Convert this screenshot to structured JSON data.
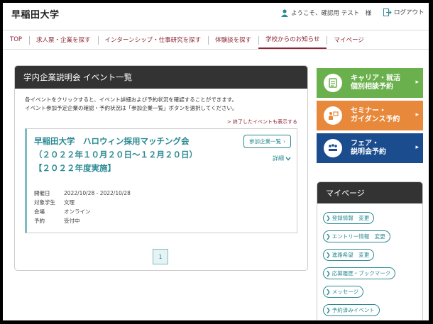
{
  "header": {
    "logo": "早稲田大学",
    "welcome": "ようこそ、確認用 テスト　様",
    "logout": "ログアウト"
  },
  "nav": [
    {
      "label": "TOP",
      "active": false
    },
    {
      "label": "求人票・企業を探す",
      "active": false
    },
    {
      "label": "インターンシップ・仕事研究を探す",
      "active": false
    },
    {
      "label": "体験談を探す",
      "active": false
    },
    {
      "label": "学校からのお知らせ",
      "active": true
    },
    {
      "label": "マイページ",
      "active": false
    }
  ],
  "panel": {
    "title": "学内企業説明会 イベント一覧",
    "intro_line1": "各イベントをクリックすると、イベント詳細および予約状況を確認することができます。",
    "intro_line2": "イベント参加予定企業の確認・予約状況は「参加企業一覧」ボタンを選択してください。",
    "past_link": "> 終了したイベントも表示する"
  },
  "event": {
    "title_line1": "早稲田大学　ハロウィン採用マッチング会",
    "title_line2": "（２０２２年１０月２０日～１２月２０日）",
    "title_line3": "【２０２２年度実施】",
    "company_button": "参加企業一覧",
    "detail": "詳細",
    "info": [
      {
        "key": "開催日",
        "value": "2022/10/28 - 2022/10/28"
      },
      {
        "key": "対象学生",
        "value": "文理"
      },
      {
        "key": "会場",
        "value": "オンライン"
      },
      {
        "key": "予約",
        "value": "受付中"
      }
    ]
  },
  "pagination": {
    "current": "1"
  },
  "side_buttons": {
    "career_line1": "キャリア・就活",
    "career_line2": "個別相談予約",
    "seminar_line1": "セミナー・",
    "seminar_line2": "ガイダンス予約",
    "fair_line1": "フェア・",
    "fair_line2": "説明会予約"
  },
  "mypage": {
    "title": "マイページ",
    "links": [
      "登録情報　変更",
      "エントリー情報　変更",
      "進路希望　変更",
      "応募履歴・ブックマーク",
      "メッセージ",
      "予約済みイベント"
    ]
  },
  "colors": {
    "brand": "#8b2636",
    "teal": "#2a8a93",
    "career": "#6ab04c",
    "seminar": "#e8883a",
    "fair": "#1a4c8e"
  }
}
